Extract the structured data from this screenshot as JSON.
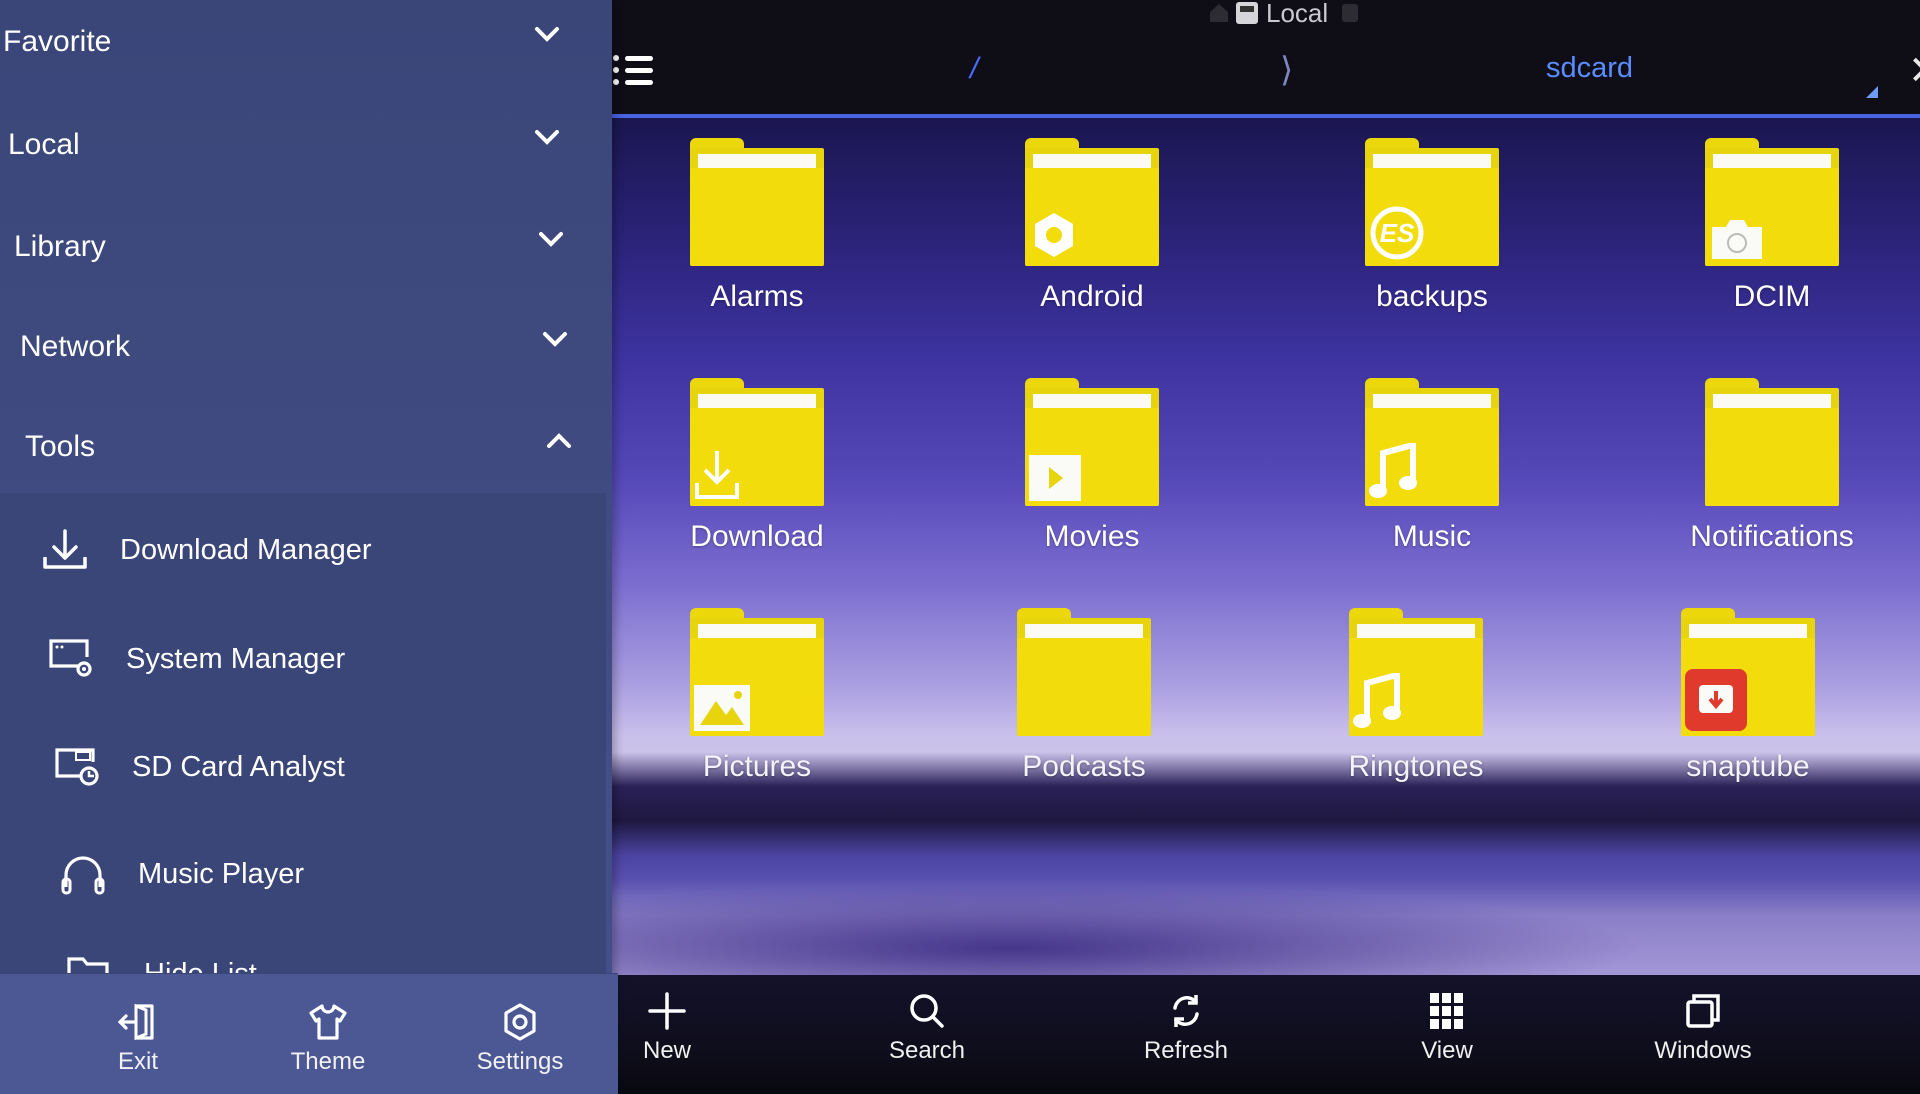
{
  "header": {
    "title": "Local",
    "breadcrumb": {
      "root": "/",
      "separator": "⟩",
      "current": "sdcard"
    },
    "close_symbol": "✕"
  },
  "sidebar": {
    "sections": [
      {
        "label": "Favorite",
        "expanded": false
      },
      {
        "label": "Local",
        "expanded": false
      },
      {
        "label": "Library",
        "expanded": false
      },
      {
        "label": "Network",
        "expanded": false
      },
      {
        "label": "Tools",
        "expanded": true
      }
    ],
    "tools": [
      {
        "label": "Download Manager",
        "icon": "download-icon"
      },
      {
        "label": "System Manager",
        "icon": "system-manager-icon"
      },
      {
        "label": "SD Card Analyst",
        "icon": "sd-card-analyst-icon"
      },
      {
        "label": "Music Player",
        "icon": "headphones-icon"
      },
      {
        "label": "Hide List",
        "icon": "hidden-folder-icon"
      }
    ],
    "bottom": [
      {
        "label": "Exit",
        "icon": "exit-icon"
      },
      {
        "label": "Theme",
        "icon": "shirt-icon"
      },
      {
        "label": "Settings",
        "icon": "gear-icon"
      }
    ]
  },
  "folders": [
    {
      "name": "Alarms",
      "badge": "none"
    },
    {
      "name": "Android",
      "badge": "gear"
    },
    {
      "name": "backups",
      "badge": "es-logo"
    },
    {
      "name": "DCIM",
      "badge": "camera"
    },
    {
      "name": "Download",
      "badge": "download"
    },
    {
      "name": "Movies",
      "badge": "play"
    },
    {
      "name": "Music",
      "badge": "music-note"
    },
    {
      "name": "Notifications",
      "badge": "none"
    },
    {
      "name": "Pictures",
      "badge": "picture"
    },
    {
      "name": "Podcasts",
      "badge": "none"
    },
    {
      "name": "Ringtones",
      "badge": "music-note"
    },
    {
      "name": "snaptube",
      "badge": "snaptube"
    }
  ],
  "toolbar": [
    {
      "label": "New",
      "icon": "plus-icon"
    },
    {
      "label": "Search",
      "icon": "search-icon"
    },
    {
      "label": "Refresh",
      "icon": "refresh-icon"
    },
    {
      "label": "View",
      "icon": "grid-view-icon"
    },
    {
      "label": "Windows",
      "icon": "windows-icon"
    }
  ],
  "colors": {
    "accent": "#4a63e0",
    "breadcrumb_current": "#5a8cff",
    "folder": "#f2dc0c",
    "sidebar": "#3f4b80",
    "snaptube_badge": "#e03a2c"
  }
}
